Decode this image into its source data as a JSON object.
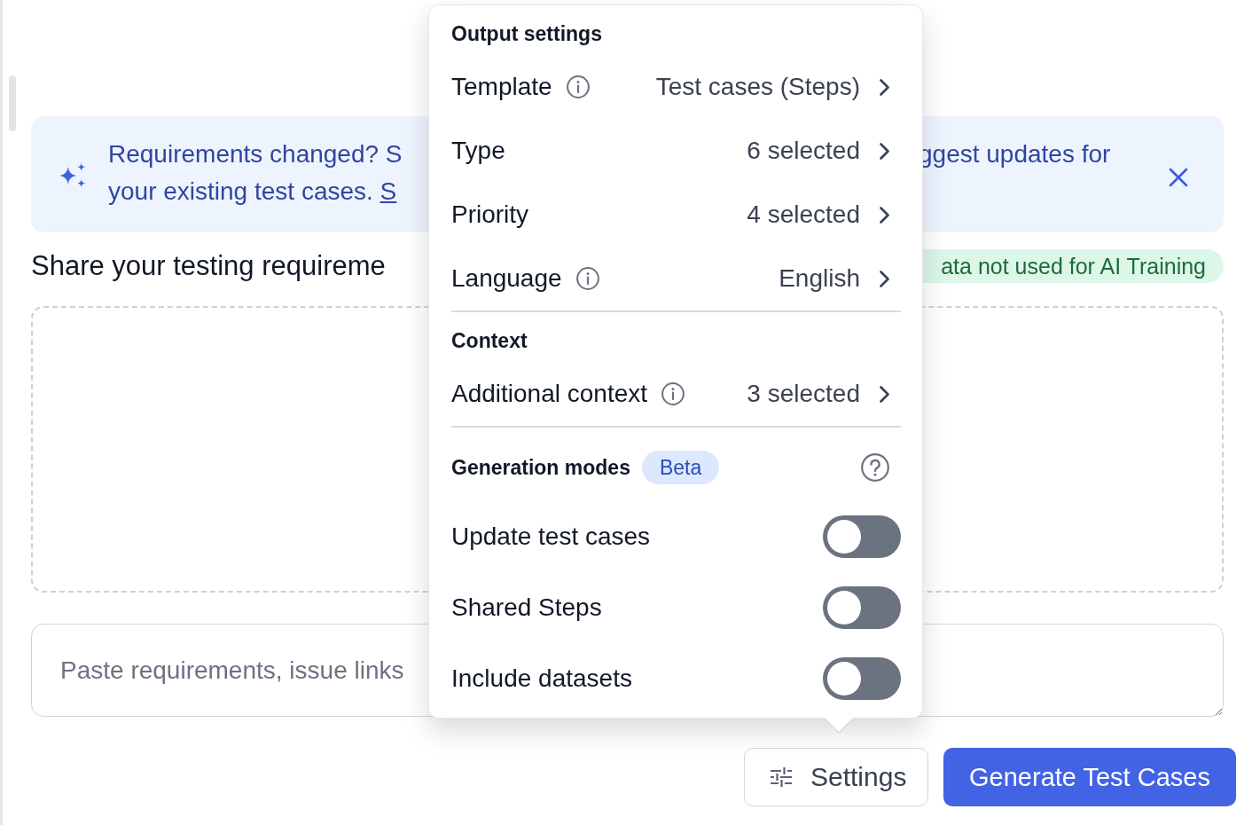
{
  "banner": {
    "message_left": [
      "Requirements changed? S",
      "your existing test cases."
    ],
    "link": "S",
    "message_right": "ggest updates for"
  },
  "heading": "Share your testing requireme",
  "privacy_badge": "ata not used for AI Training",
  "requirements_field": {
    "placeholder": "Paste requirements, issue links"
  },
  "settings_popover": {
    "sections": [
      {
        "title": "Output settings",
        "rows": [
          {
            "kind": "select",
            "label": "Template",
            "info": true,
            "value": "Test cases (Steps)"
          },
          {
            "kind": "select",
            "label": "Type",
            "info": false,
            "value": "6 selected"
          },
          {
            "kind": "select",
            "label": "Priority",
            "info": false,
            "value": "4 selected"
          },
          {
            "kind": "select",
            "label": "Language",
            "info": true,
            "value": "English"
          }
        ]
      },
      {
        "title": "Context",
        "rows": [
          {
            "kind": "select",
            "label": "Additional context",
            "info": true,
            "value": "3 selected"
          }
        ]
      },
      {
        "title": "Generation modes",
        "badge": "Beta",
        "help": true,
        "rows": [
          {
            "kind": "toggle",
            "label": "Update test cases",
            "on": false
          },
          {
            "kind": "toggle",
            "label": "Shared Steps",
            "on": false
          },
          {
            "kind": "toggle",
            "label": "Include datasets",
            "on": false
          }
        ]
      }
    ]
  },
  "buttons": [
    {
      "kind": "secondary",
      "label": "Settings"
    },
    {
      "kind": "primary",
      "label": "Generate Test Cases"
    }
  ]
}
